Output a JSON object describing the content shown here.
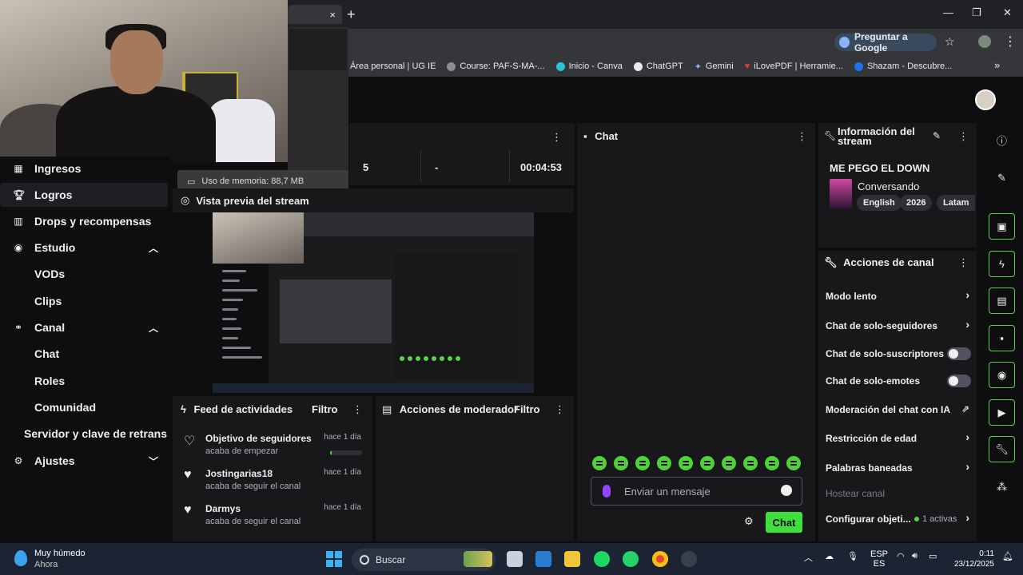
{
  "browser": {
    "tab_close": "×",
    "new_tab": "+",
    "ask_google": "Preguntar a Google",
    "window_controls": {
      "minimize": "—",
      "maximize": "❐",
      "close": "✕"
    },
    "bookmarks": [
      "Área personal | UG IE",
      "Course: PAF-S-MA-...",
      "Inicio - Canva",
      "ChatGPT",
      "Gemini",
      "iLovePDF | Herramie...",
      "Shazam - Descubre..."
    ],
    "bookmarks_more": "»",
    "memory_tooltip": "Uso de memoria: 88,7 MB"
  },
  "sidebar": {
    "items": [
      {
        "label": "Ingresos",
        "icon": "revenue-icon"
      },
      {
        "label": "Logros",
        "icon": "trophy-icon"
      },
      {
        "label": "Drops y recompensas",
        "icon": "drops-icon"
      },
      {
        "label": "Estudio",
        "icon": "studio-icon"
      },
      {
        "label": "VODs"
      },
      {
        "label": "Clips"
      },
      {
        "label": "Canal",
        "icon": "channel-icon"
      },
      {
        "label": "Chat"
      },
      {
        "label": "Roles"
      },
      {
        "label": "Comunidad"
      },
      {
        "label": "Servidor y clave de retrans"
      },
      {
        "label": "Ajustes",
        "icon": "gear-icon"
      }
    ]
  },
  "stats": {
    "viewers": "5",
    "followers": "-",
    "uptime": "00:04:53"
  },
  "preview": {
    "title": "Vista previa del stream"
  },
  "activity_feed": {
    "title": "Feed de actividades",
    "filter": "Filtro",
    "items": [
      {
        "name": "Objetivo de seguidores",
        "sub": "acaba de empezar",
        "time": "hace 1 día",
        "progress": 0.05
      },
      {
        "name": "Jostingarias18",
        "sub": "acaba de seguir el canal",
        "time": "hace 1 día"
      },
      {
        "name": "Darmys",
        "sub": "acaba de seguir el canal",
        "time": "hace 1 día"
      }
    ]
  },
  "mod_actions": {
    "title": "Acciones de moderador",
    "filter": "Filtro"
  },
  "chat": {
    "title": "Chat",
    "placeholder": "Enviar un mensaje",
    "send_label": "Chat",
    "emote_count": 10
  },
  "stream_info": {
    "title": "Información del stream",
    "stream_title": "ME PEGO EL DOWN",
    "category": "Conversando",
    "tags": [
      "English",
      "2026",
      "Latam"
    ]
  },
  "channel_actions": {
    "title": "Acciones de canal",
    "rows": [
      {
        "label": "Modo lento",
        "type": "arrow"
      },
      {
        "label": "Chat de solo-seguidores",
        "type": "arrow"
      },
      {
        "label": "Chat de solo-suscriptores",
        "type": "toggle"
      },
      {
        "label": "Chat de solo-emotes",
        "type": "toggle"
      },
      {
        "label": "Moderación del chat con IA",
        "type": "external"
      },
      {
        "label": "Restricción de edad",
        "type": "arrow"
      },
      {
        "label": "Palabras baneadas",
        "type": "arrow"
      },
      {
        "label": "Hostear canal",
        "type": "disabled"
      },
      {
        "label": "Configurar objeti...",
        "type": "arrow",
        "badge": "1 activas"
      }
    ]
  },
  "taskbar": {
    "weather_title": "Muy húmedo",
    "weather_sub": "Ahora",
    "search": "Buscar",
    "lang_top": "ESP",
    "lang_bottom": "ES",
    "time": "0:11",
    "date": "23/12/2025"
  },
  "colors": {
    "accent_green": "#5ad14a",
    "twitch_purple": "#9147ff",
    "panel": "#18181b",
    "background": "#0e0e10"
  }
}
